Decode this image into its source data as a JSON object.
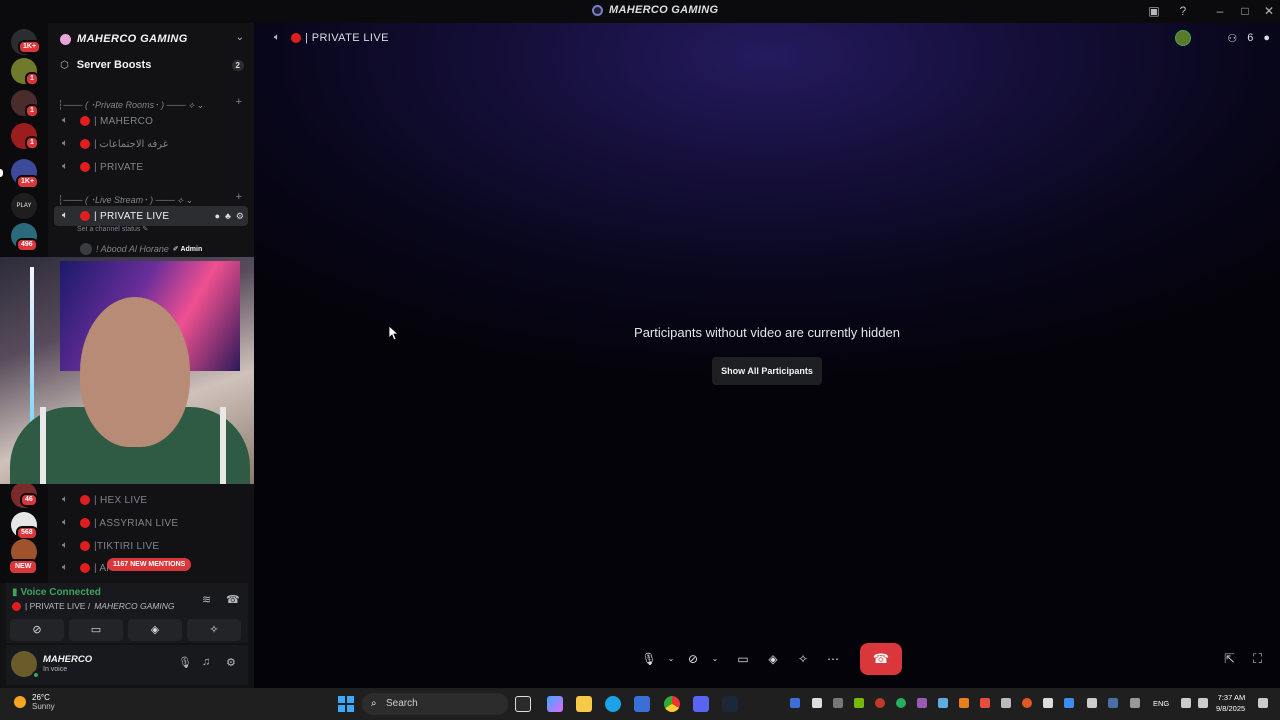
{
  "window": {
    "title": "MAHERCO GAMING"
  },
  "rail": {
    "badges": [
      "1K+",
      "1",
      "1",
      "1",
      "1K+",
      "496",
      "46",
      "568"
    ],
    "new_label": "NEW",
    "play_label": "PLAY"
  },
  "server": {
    "name": "MAHERCO GAMING",
    "boosts_label": "Server Boosts",
    "boosts_count": "2"
  },
  "categories": [
    {
      "label": "┆─── ( ･Private Rooms･ ) ───  ⟡  ⌄"
    },
    {
      "label": "┆─── ( ･Live Stream･ ) ───  ⟡  ⌄"
    }
  ],
  "channels_private": [
    {
      "name": "| MAHERCO"
    },
    {
      "name": "| غرفه الاجتماعات"
    },
    {
      "name": "| PRIVATE"
    }
  ],
  "channel_active": {
    "name": "| PRIVATE LIVE",
    "status_hint": "Set a channel status ✎",
    "member_name": "! Abood Al Horane",
    "member_role": "✐ Admin"
  },
  "channels_lower": [
    {
      "name": "| HEX LIVE"
    },
    {
      "name": "| ASSYRIAN LIVE"
    },
    {
      "name": "|TIKTIRI LIVE"
    },
    {
      "name": "| Al"
    }
  ],
  "mentions": "1167 NEW MENTIONS",
  "voice": {
    "status": "Voice Connected",
    "channel": "| PRIVATE LIVE / ",
    "server": "MAHERCO GAMING"
  },
  "user": {
    "name": "MAHERCO",
    "status": "In voice"
  },
  "main": {
    "channel": "| PRIVATE LIVE",
    "participant_count": "6",
    "hidden_message": "Participants without video are currently hidden",
    "show_all": "Show All Participants"
  },
  "taskbar": {
    "temp": "26°C",
    "weather": "Sunny",
    "search": "Search",
    "lang": "ENG",
    "time": "7:37 AM",
    "date": "9/8/2025"
  },
  "colors": {
    "accent_red": "#da373c",
    "voice_green": "#3ba55c",
    "live_dot": "#e01e1e"
  }
}
